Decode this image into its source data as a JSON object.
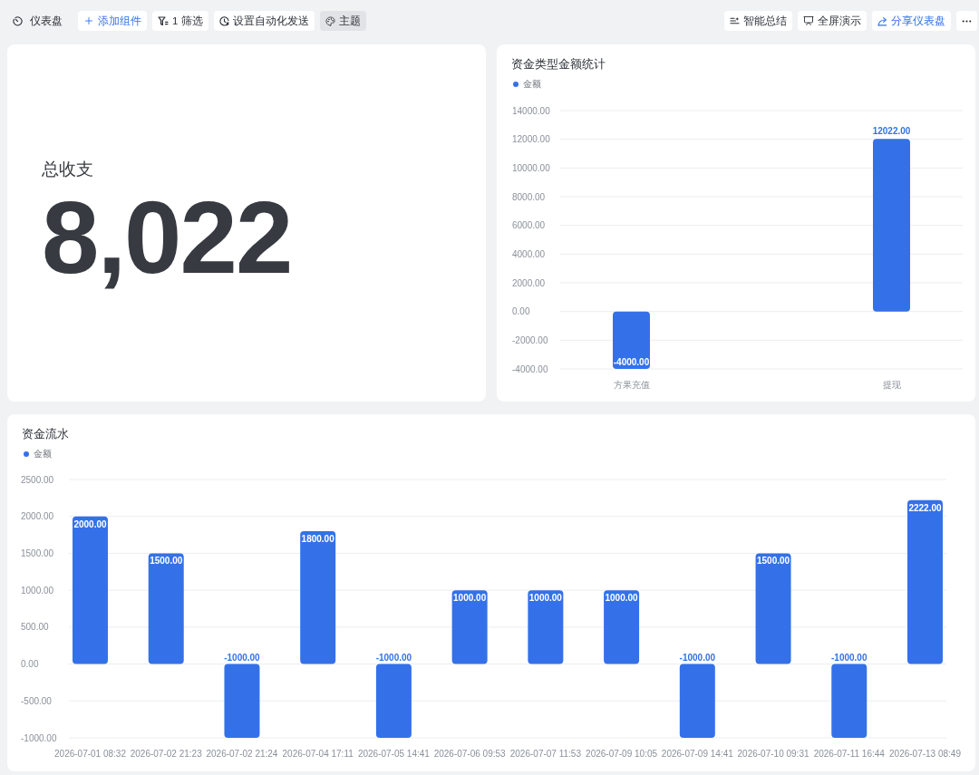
{
  "toolbar": {
    "title": "仪表盘",
    "left_buttons": [
      {
        "label": "添加组件",
        "kind": "primary",
        "active": false
      },
      {
        "label": "1 筛选",
        "kind": "default",
        "active": false
      },
      {
        "label": "设置自动化发送",
        "kind": "default",
        "active": false
      },
      {
        "label": "主题",
        "kind": "default",
        "active": true
      }
    ],
    "right_buttons": [
      {
        "label": "智能总结",
        "kind": "default",
        "active": false
      },
      {
        "label": "全屏演示",
        "kind": "default",
        "active": false
      },
      {
        "label": "分享仪表盘",
        "kind": "primary",
        "active": false
      }
    ]
  },
  "stat_card": {
    "label": "总收支",
    "value": "8,022"
  },
  "type_chart": {
    "chart_data": {
      "type": "bar",
      "title": "资金类型金额统计",
      "categories": [
        "方果充值",
        "提现"
      ],
      "series": [
        {
          "name": "金额",
          "color": "#3471e9",
          "values": [
            -4000,
            12022
          ]
        }
      ],
      "ylim": [
        -4000,
        14000
      ],
      "yticks": [
        {
          "value": -4000,
          "label": "-4000.00"
        },
        {
          "value": -2000,
          "label": "-2000.00"
        },
        {
          "value": 0,
          "label": "0.00"
        },
        {
          "value": 2000,
          "label": "2000.00"
        },
        {
          "value": 4000,
          "label": "4000.00"
        },
        {
          "value": 6000,
          "label": "6000.00"
        },
        {
          "value": 8000,
          "label": "8000.00"
        },
        {
          "value": 10000,
          "label": "10000.00"
        },
        {
          "value": 12000,
          "label": "12000.00"
        },
        {
          "value": 14000,
          "label": "14000.00"
        }
      ],
      "grid": true,
      "value_labels": [
        "-4000.00",
        "12022.00"
      ]
    }
  },
  "flow_chart": {
    "chart_data": {
      "type": "bar",
      "title": "资金流水",
      "categories": [
        "2026-07-01 08:32",
        "2026-07-02 21:23",
        "2026-07-02 21:24",
        "2026-07-04 17:11",
        "2026-07-05 14:41",
        "2026-07-06 09:53",
        "2026-07-07 11:53",
        "2026-07-09 10:05",
        "2026-07-09 14:41",
        "2026-07-10 09:31",
        "2026-07-11 16:44",
        "2026-07-13 08:49"
      ],
      "series": [
        {
          "name": "金额",
          "color": "#3471e9",
          "values": [
            2000,
            1500,
            -1000,
            1800,
            -1000,
            1000,
            1000,
            1000,
            -1000,
            1500,
            -1000,
            2222
          ]
        }
      ],
      "ylim": [
        -1000,
        2500
      ],
      "yticks": [
        {
          "value": -1000,
          "label": "-1000.00"
        },
        {
          "value": -500,
          "label": "-500.00"
        },
        {
          "value": 0,
          "label": "0.00"
        },
        {
          "value": 500,
          "label": "500.00"
        },
        {
          "value": 1000,
          "label": "1000.00"
        },
        {
          "value": 1500,
          "label": "1500.00"
        },
        {
          "value": 2000,
          "label": "2000.00"
        },
        {
          "value": 2500,
          "label": "2500.00"
        }
      ],
      "grid": true,
      "value_labels": [
        "2000.00",
        "1500.00",
        "-1000.00",
        "1800.00",
        "-1000.00",
        "1000.00",
        "1000.00",
        "1000.00",
        "-1000.00",
        "1500.00",
        "-1000.00",
        "2222.00"
      ]
    }
  }
}
